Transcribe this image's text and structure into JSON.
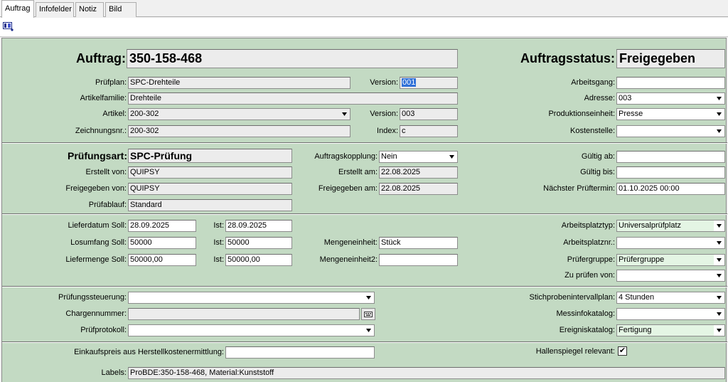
{
  "tabs": [
    "Auftrag",
    "Infofelder",
    "Notiz",
    "Bild"
  ],
  "header": {
    "auftrag_label": "Auftrag:",
    "auftrag_value": "350-158-468",
    "status_label": "Auftragsstatus:",
    "status_value": "Freigegeben"
  },
  "section1": {
    "pruefplan_label": "Prüfplan:",
    "pruefplan_value": "SPC-Drehteile",
    "version_label": "Version:",
    "version_value": "001",
    "artikelfamilie_label": "Artikelfamilie:",
    "artikelfamilie_value": "Drehteile",
    "artikel_label": "Artikel:",
    "artikel_value": "200-302",
    "artikel_version_label": "Version:",
    "artikel_version_value": "003",
    "zeichnungsnr_label": "Zeichnungsnr.:",
    "zeichnungsnr_value": "200-302",
    "index_label": "Index:",
    "index_value": "c",
    "arbeitsgang_label": "Arbeitsgang:",
    "arbeitsgang_value": "",
    "adresse_label": "Adresse:",
    "adresse_value": "003",
    "produktionseinheit_label": "Produktionseinheit:",
    "produktionseinheit_value": "Presse",
    "kostenstelle_label": "Kostenstelle:",
    "kostenstelle_value": ""
  },
  "section2": {
    "pruefungsart_label": "Prüfungsart:",
    "pruefungsart_value": "SPC-Prüfung",
    "erstellt_von_label": "Erstellt von:",
    "erstellt_von_value": "QUIPSY",
    "freigegeben_von_label": "Freigegeben von:",
    "freigegeben_von_value": "QUIPSY",
    "pruefablauf_label": "Prüfablauf:",
    "pruefablauf_value": "Standard",
    "auftragskopplung_label": "Auftragskopplung:",
    "auftragskopplung_value": "Nein",
    "erstellt_am_label": "Erstellt am:",
    "erstellt_am_value": "22.08.2025",
    "freigegeben_am_label": "Freigegeben am:",
    "freigegeben_am_value": "22.08.2025",
    "gueltig_ab_label": "Gültig ab:",
    "gueltig_ab_value": "",
    "gueltig_bis_label": "Gültig bis:",
    "gueltig_bis_value": "",
    "naechster_label": "Nächster Prüftermin:",
    "naechster_value": "01.10.2025  00:00"
  },
  "section3": {
    "lieferdatum_label": "Lieferdatum Soll:",
    "lieferdatum_value": "28.09.2025",
    "lieferdatum_ist_label": "Ist:",
    "lieferdatum_ist_value": "28.09.2025",
    "losumfang_label": "Losumfang Soll:",
    "losumfang_value": "50000",
    "losumfang_ist_label": "Ist:",
    "losumfang_ist_value": "50000",
    "liefermenge_label": "Liefermenge Soll:",
    "liefermenge_value": "50000,00",
    "liefermenge_ist_label": "Ist:",
    "liefermenge_ist_value": "50000,00",
    "mengeneinheit_label": "Mengeneinheit:",
    "mengeneinheit_value": "Stück",
    "mengeneinheit2_label": "Mengeneinheit2:",
    "mengeneinheit2_value": "",
    "arbeitsplatztyp_label": "Arbeitsplatztyp:",
    "arbeitsplatztyp_value": "Universalprüfplatz",
    "arbeitsplatznr_label": "Arbeitsplatznr.:",
    "arbeitsplatznr_value": "",
    "pruefergruppe_label": "Prüfergruppe:",
    "pruefergruppe_value": "Prüfergruppe",
    "zu_pruefen_label": "Zu prüfen von:",
    "zu_pruefen_value": ""
  },
  "section4": {
    "pruefungssteuerung_label": "Prüfungssteuerung:",
    "pruefungssteuerung_value": "",
    "chargennummer_label": "Chargennummer:",
    "chargennummer_value": "",
    "pruefprotokoll_label": "Prüfprotokoll:",
    "pruefprotokoll_value": "",
    "stichproben_label": "Stichprobenintervallplan:",
    "stichproben_value": "4 Stunden",
    "messinfo_label": "Messinfokatalog:",
    "messinfo_value": "",
    "ereignis_label": "Ereigniskatalog:",
    "ereignis_value": "Fertigung"
  },
  "section5": {
    "einkaufspreis_label": "Einkaufspreis aus Herstellkostenermittlung:",
    "einkaufspreis_value": "",
    "hallenspiegel_label": "Hallenspiegel relevant:",
    "hallenspiegel_checked": "✔",
    "labels_label": "Labels:",
    "labels_value": "ProBDE:350-158-468, Material:Kunststoff"
  },
  "colors": {
    "panel_bg": "#c3dac3",
    "selection": "#3070d8",
    "green_field": "#e4f5e4"
  }
}
